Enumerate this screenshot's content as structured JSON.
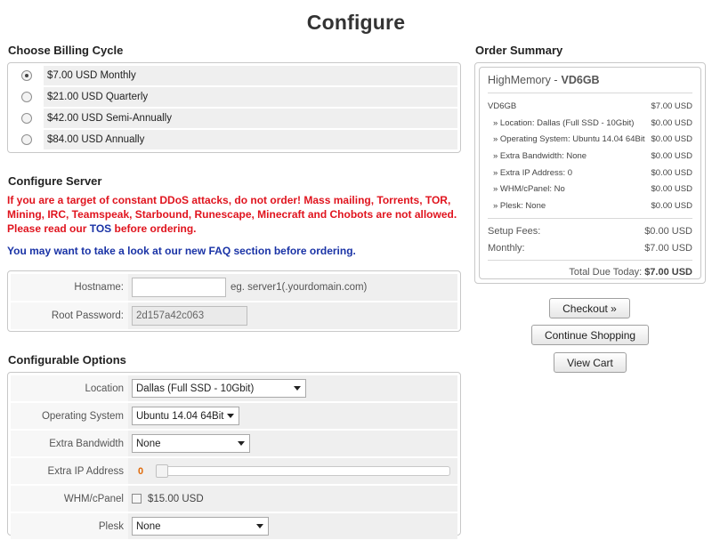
{
  "page": {
    "title": "Configure"
  },
  "billing": {
    "title": "Choose Billing Cycle",
    "options": [
      {
        "label": "$7.00 USD Monthly",
        "selected": true
      },
      {
        "label": "$21.00 USD Quarterly",
        "selected": false
      },
      {
        "label": "$42.00 USD Semi-Annually",
        "selected": false
      },
      {
        "label": "$84.00 USD Annually",
        "selected": false
      }
    ]
  },
  "server": {
    "title": "Configure Server",
    "warning_line1": "If you are a target of constant DDoS attacks, do not order! Mass mailing, Torrents, TOR,",
    "warning_line2": "Mining, IRC, Teamspeak, Starbound, Runescape, Minecraft and Chobots are not allowed.",
    "warning_line3_prefix": "Please read our ",
    "warning_tos": "TOS",
    "warning_line3_suffix": " before ordering.",
    "faq_prefix": "You may want to take a look at our new ",
    "faq_link": "FAQ",
    "faq_suffix": " section before ordering.",
    "hostname_label": "Hostname:",
    "hostname_value": "",
    "hostname_hint": "eg. server1(.yourdomain.com)",
    "password_label": "Root Password:",
    "password_value": "2d157a42c063"
  },
  "options": {
    "title": "Configurable Options",
    "location_label": "Location",
    "location_value": "Dallas (Full SSD - 10Gbit)",
    "os_label": "Operating System",
    "os_value": "Ubuntu 14.04 64Bit",
    "bandwidth_label": "Extra Bandwidth",
    "bandwidth_value": "None",
    "ip_label": "Extra IP Address",
    "ip_value": "0",
    "whm_label": "WHM/cPanel",
    "whm_price": "$15.00 USD",
    "whm_checked": false,
    "plesk_label": "Plesk",
    "plesk_value": "None"
  },
  "summary": {
    "title": "Order Summary",
    "product_group": "HighMemory - ",
    "product_name": "VD6GB",
    "items": [
      {
        "name": "VD6GB",
        "price": "$7.00 USD"
      },
      {
        "name": "» Location: Dallas (Full SSD - 10Gbit)",
        "price": "$0.00 USD"
      },
      {
        "name": "» Operating System: Ubuntu 14.04 64Bit",
        "price": "$0.00 USD"
      },
      {
        "name": "» Extra Bandwidth: None",
        "price": "$0.00 USD"
      },
      {
        "name": "» Extra IP Address: 0",
        "price": "$0.00 USD"
      },
      {
        "name": "» WHM/cPanel: No",
        "price": "$0.00 USD"
      },
      {
        "name": "» Plesk: None",
        "price": "$0.00 USD"
      }
    ],
    "setup_label": "Setup Fees:",
    "setup_value": "$0.00 USD",
    "monthly_label": "Monthly:",
    "monthly_value": "$7.00 USD",
    "total_label": "Total Due Today: ",
    "total_value": "$7.00 USD"
  },
  "buttons": {
    "checkout": "Checkout »",
    "continue": "Continue Shopping",
    "view_cart": "View Cart"
  }
}
